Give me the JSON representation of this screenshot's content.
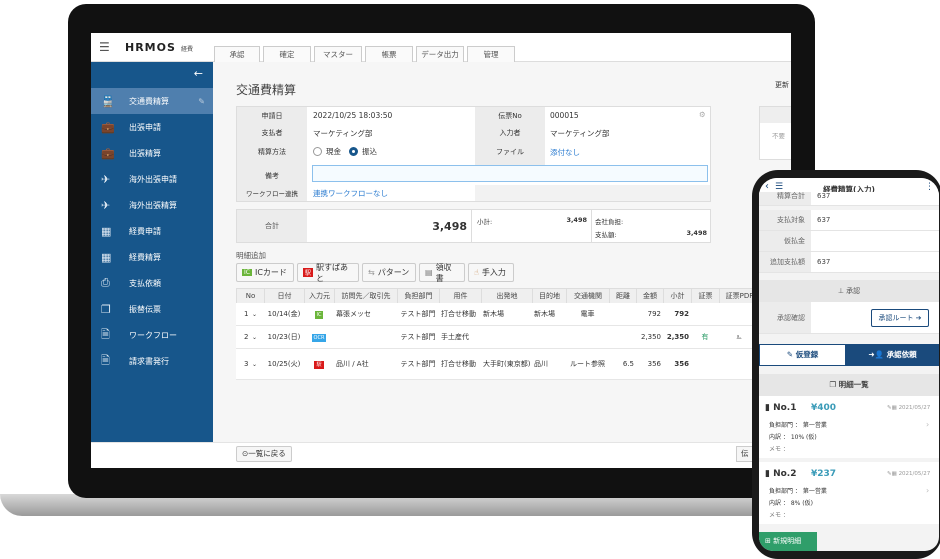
{
  "app": {
    "logo": "HRMOS",
    "logo_sub": "経費",
    "menu_icon": "hamburger-icon"
  },
  "tabs": [
    "承認",
    "確定",
    "マスター",
    "帳票",
    "データ出力",
    "管理"
  ],
  "sidebar": {
    "collapse_icon": "arrow-left-icon",
    "items": [
      {
        "label": "交通費精算",
        "icon": "train-icon",
        "active": true
      },
      {
        "label": "出張申請",
        "icon": "briefcase-icon"
      },
      {
        "label": "出張精算",
        "icon": "briefcase-icon"
      },
      {
        "label": "海外出張申請",
        "icon": "airplane-icon"
      },
      {
        "label": "海外出張精算",
        "icon": "airplane-icon"
      },
      {
        "label": "経費申請",
        "icon": "calculator-icon"
      },
      {
        "label": "経費精算",
        "icon": "calculator-icon"
      },
      {
        "label": "支払依頼",
        "icon": "payment-icon"
      },
      {
        "label": "振替伝票",
        "icon": "folders-icon"
      },
      {
        "label": "ワークフロー",
        "icon": "document-icon"
      },
      {
        "label": "請求書発行",
        "icon": "invoice-icon"
      }
    ]
  },
  "page": {
    "title": "交通費精算",
    "update_label": "更新",
    "form": {
      "date_label": "申請日",
      "date": "2022/10/25 18:03:50",
      "slip_label": "伝票No",
      "slip": "000015",
      "payer_label": "支払者",
      "payer": "マーケティング部",
      "inputter_label": "入力者",
      "inputter": "マーケティング部",
      "method_label": "精算方法",
      "method_cash": "現金",
      "method_transfer": "振込",
      "method_selected": "振込",
      "file_label": "ファイル",
      "file": "添付なし",
      "note_label": "備考",
      "note": "",
      "workflow_label": "ワークフロー連携",
      "workflow": "連携ワークフローなし"
    },
    "side_panel": {
      "value": "不要"
    },
    "totals": {
      "total_label": "合計",
      "total": "3,498",
      "subtotal_label": "小計:",
      "subtotal": "3,498",
      "company_label": "会社負担:",
      "pay_label": "支払額:",
      "pay": "3,498"
    },
    "add_label": "明細追加",
    "add_buttons": [
      "ICカード",
      "駅すぱあと",
      "パターン",
      "領収書",
      "手入力"
    ],
    "table": {
      "headers": [
        "No",
        "日付",
        "入力元",
        "訪問先／取引先",
        "負担部門",
        "用件",
        "出発地",
        "目的地",
        "交通機関",
        "距離",
        "金額",
        "小計",
        "証票",
        "証票PDF"
      ],
      "rows": [
        {
          "no": "1",
          "date": "10/14(金)",
          "source": "IC",
          "visit": "幕張メッセ",
          "dept": "テスト部門",
          "purpose": "打合せ移動",
          "from": "新木場",
          "to": "新木場",
          "transport": "電車",
          "distance": "",
          "amount": "792",
          "subtotal": "792",
          "receipt": "",
          "pdf": ""
        },
        {
          "no": "2",
          "date": "10/23(日)",
          "source": "OCR",
          "visit": "",
          "dept": "テスト部門",
          "purpose": "手土産代",
          "from": "",
          "to": "",
          "transport": "",
          "distance": "",
          "amount": "2,350",
          "subtotal": "2,350",
          "receipt": "有",
          "pdf": "pdf-icon"
        },
        {
          "no": "3",
          "date": "10/25(火)",
          "source": "駅",
          "visit": "品川 / A社",
          "dept": "テスト部門",
          "purpose": "打合せ移動",
          "from": "大手町(東京都)",
          "to": "品川",
          "transport": "ルート参照",
          "distance": "6.5",
          "amount": "356",
          "subtotal": "356",
          "receipt": "",
          "pdf": ""
        }
      ]
    },
    "back_label": "一覧に戻る",
    "slip_btn": "伝"
  },
  "phone": {
    "title": "経費精算(入力)",
    "rows": [
      {
        "k": "精算合計",
        "v": "637"
      },
      {
        "k": "支払対象",
        "v": "637"
      },
      {
        "k": "仮払金",
        "v": ""
      },
      {
        "k": "追加支払額",
        "v": "637"
      }
    ],
    "approval_header": "承認",
    "approval_confirm": "承認確認",
    "route_btn": "承認ルート",
    "draft_btn": "仮登録",
    "request_btn": "承認依頼",
    "list_header": "明細一覧",
    "items": [
      {
        "no": "No.1",
        "amount": "¥400",
        "date": "2021/05/27",
        "dept": "負担部門 ： 第一営業",
        "detail": "内訳 ： 10% (仮)",
        "memo": "メモ ："
      },
      {
        "no": "No.2",
        "amount": "¥237",
        "date": "2021/05/27",
        "dept": "負担部門 ： 第一営業",
        "detail": "内訳 ： 8% (仮)",
        "memo": "メモ ："
      }
    ],
    "new_btn": "新規明細"
  },
  "colors": {
    "sidebar": "#17568b",
    "accent": "#1a4a7c",
    "link": "#2a7bd0",
    "amount": "#3a9bb8",
    "green": "#2f9e6a"
  }
}
